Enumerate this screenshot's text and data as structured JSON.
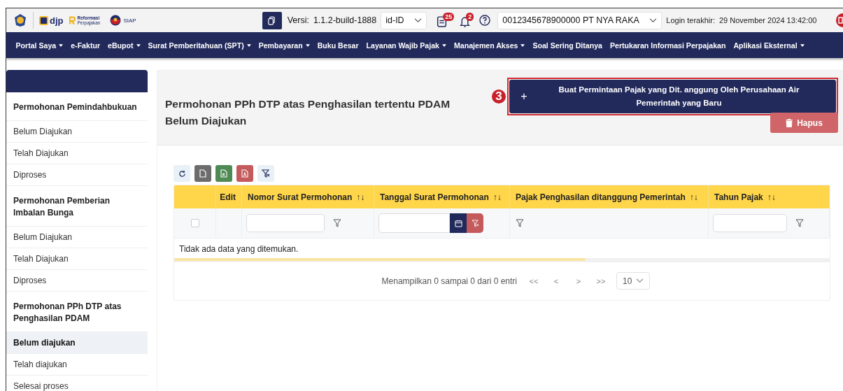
{
  "header": {
    "logos": {
      "djp": "djp",
      "reform_1": "Reformasi",
      "reform_2": "Perpajakan",
      "siap": "SIAP"
    },
    "version_label": "Versi:",
    "version": "1.1.2-build-1888",
    "language": "id-ID",
    "notes_badge": "25",
    "bell_badge": "2",
    "taxpayer": "0012345678900000 PT NYA RAKA",
    "login_label": "Login terakhir:",
    "login_time": "29 November 2024 13:42:00"
  },
  "nav": [
    {
      "label": "Portal Saya",
      "dropdown": true
    },
    {
      "label": "e-Faktur",
      "dropdown": false
    },
    {
      "label": "eBupot",
      "dropdown": true
    },
    {
      "label": "Surat Pemberitahuan (SPT)",
      "dropdown": true
    },
    {
      "label": "Pembayaran",
      "dropdown": true
    },
    {
      "label": "Buku Besar",
      "dropdown": false
    },
    {
      "label": "Layanan Wajib Pajak",
      "dropdown": true
    },
    {
      "label": "Manajemen Akses",
      "dropdown": true
    },
    {
      "label": "Soal Sering Ditanya",
      "dropdown": false
    },
    {
      "label": "Pertukaran Informasi Perpajakan",
      "dropdown": false
    },
    {
      "label": "Aplikasi Eksternal",
      "dropdown": true
    }
  ],
  "sidebar": [
    {
      "title": "Permohonan Pemindahbukuan",
      "items": [
        {
          "label": "Belum Diajukan",
          "selected": false
        },
        {
          "label": "Telah Diajukan",
          "selected": false
        },
        {
          "label": "Diproses",
          "selected": false
        }
      ]
    },
    {
      "title": "Permohonan Pemberian Imbalan Bunga",
      "items": [
        {
          "label": "Belum Diajukan",
          "selected": false
        },
        {
          "label": "Telah Diajukan",
          "selected": false
        },
        {
          "label": "Diproses",
          "selected": false
        }
      ]
    },
    {
      "title": "Permohonan PPh DTP atas Penghasilan PDAM",
      "items": [
        {
          "label": "Belum diajukan",
          "selected": true
        },
        {
          "label": "Telah diajukan",
          "selected": false
        },
        {
          "label": "Selesai proses",
          "selected": false
        }
      ]
    }
  ],
  "page": {
    "title": "Permohonan PPh DTP atas Penghasilan tertentu PDAM Belum Diajukan",
    "step_marker": "3",
    "create_button": {
      "icon": "+",
      "label": "Buat Permintaan Pajak yang Dit. anggung Oleh Perusahaan Air Pemerintah yang Baru"
    },
    "delete_button": "Hapus"
  },
  "table": {
    "columns": [
      {
        "kind": "checkbox",
        "checked": false
      },
      {
        "label": "Edit",
        "kind": "plain"
      },
      {
        "label": "Nomor Surat Permohonan",
        "sort": "↑↓",
        "kind": "text"
      },
      {
        "label": "Tanggal Surat Permohonan",
        "sort": "↑↓",
        "kind": "date"
      },
      {
        "label": "Pajak Penghasilan ditanggung Pemerintah",
        "sort": "↑↓",
        "kind": "icon"
      },
      {
        "label": "Tahun Pajak",
        "sort": "↑↓",
        "kind": "text"
      }
    ],
    "empty_message": "Tidak ada data yang ditemukan.",
    "pagination": {
      "summary": "Menampilkan 0 sampai 0 dari 0 entri",
      "first": "<<",
      "prev": "<",
      "next": ">",
      "last": ">>",
      "page_size": "10"
    }
  }
}
